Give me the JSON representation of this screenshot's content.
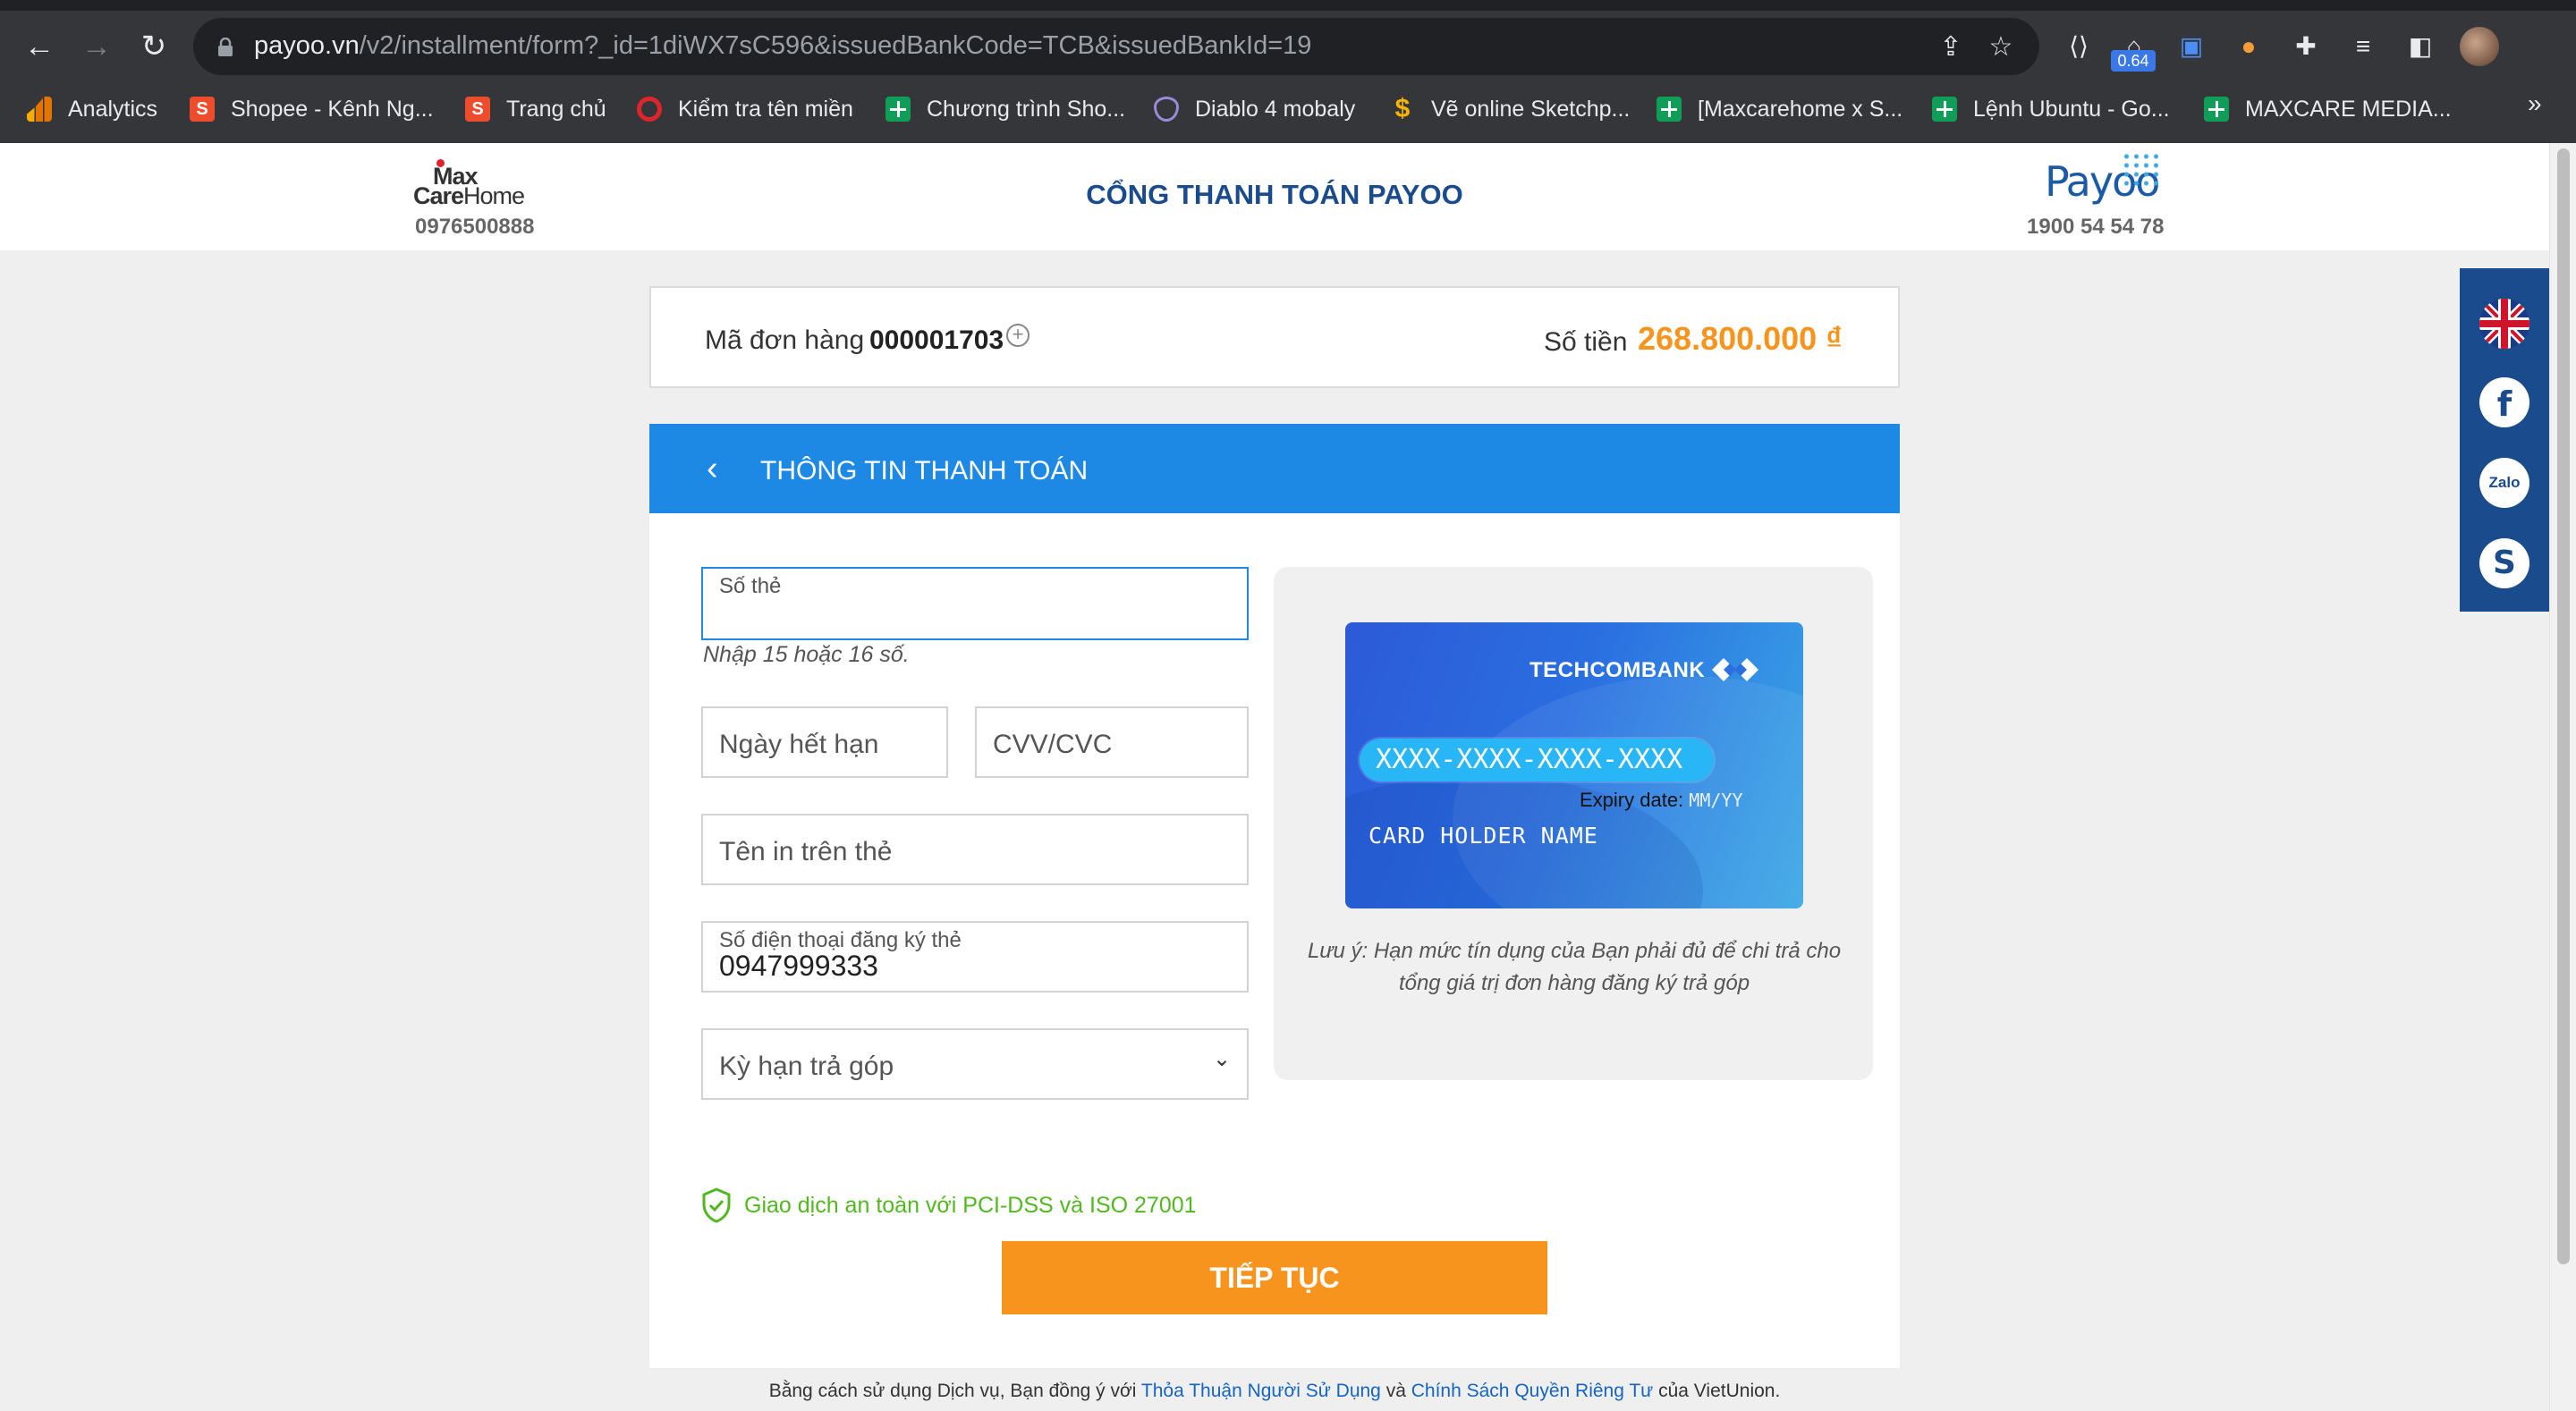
{
  "browser": {
    "url_host": "payoo.vn",
    "url_path": "/v2/installment/form?_id=1diWX7sC596&issuedBankCode=TCB&issuedBankId=19",
    "extension_badge": "0.64",
    "bookmarks": [
      {
        "label": "Analytics",
        "icon": "analytics-icon"
      },
      {
        "label": "Shopee - Kênh Ng...",
        "icon": "shopee-icon"
      },
      {
        "label": "Trang chủ",
        "icon": "shopee-icon"
      },
      {
        "label": "Kiểm tra tên miền",
        "icon": "opera-icon"
      },
      {
        "label": "Chương trình Sho...",
        "icon": "sheets-icon"
      },
      {
        "label": "Diablo 4 mobaly",
        "icon": "diablo-icon"
      },
      {
        "label": "Vẽ online Sketchp...",
        "icon": "sketchpad-icon"
      },
      {
        "label": "[Maxcarehome x S...",
        "icon": "sheets-icon"
      },
      {
        "label": "Lệnh Ubuntu - Go...",
        "icon": "sheets-icon"
      },
      {
        "label": "MAXCARE MEDIA...",
        "icon": "sheets-icon"
      }
    ],
    "more": "»"
  },
  "header": {
    "merchant_logo_line1": "Max",
    "merchant_logo_line2a": "Care",
    "merchant_logo_line2b": "Home",
    "merchant_phone": "0976500888",
    "title": "CỔNG THANH TOÁN PAYOO",
    "payoo_logo": "Payoo",
    "payoo_phone": "1900 54 54 78"
  },
  "order": {
    "label": "Mã đơn hàng",
    "id": "000001703",
    "amount_label": "Số tiền",
    "amount": "268.800.000 ₫"
  },
  "section": {
    "title": "THÔNG TIN THANH TOÁN"
  },
  "form": {
    "card_number_label": "Số thẻ",
    "card_number_hint": "Nhập 15 hoặc 16 số.",
    "expiry_placeholder": "Ngày hết hạn",
    "cvv_placeholder": "CVV/CVC",
    "holder_placeholder": "Tên in trên thẻ",
    "phone_label": "Số điện thoại đăng ký thẻ",
    "phone_value": "0947999333",
    "term_selected": "Kỳ hạn trả góp"
  },
  "card": {
    "bank_name": "TECHCOMBANK",
    "number_mask": "XXXX-XXXX-XXXX-XXXX",
    "expiry_label": "Expiry date:",
    "expiry_mask": "MM/YY",
    "holder_mask": "CARD HOLDER NAME",
    "note": "Lưu ý: Hạn mức tín dụng của Bạn phải đủ để chi trả cho tổng giá trị đơn hàng đăng ký trả góp"
  },
  "security_text": "Giao dịch an toàn với PCI-DSS và ISO 27001",
  "submit_label": "TIẾP TỤC",
  "footer": {
    "prefix": "Bằng cách sử dụng Dịch vụ, Bạn đồng ý với",
    "terms": "Thỏa Thuận Người Sử Dụng",
    "and": "và",
    "privacy": "Chính Sách Quyền Riêng Tư",
    "suffix": "của VietUnion."
  },
  "social": {
    "zalo": "Zalo",
    "facebook": "f",
    "skype": "S"
  },
  "colors": {
    "primary_blue": "#1e88e5",
    "accent_orange": "#f7941d",
    "secure_green": "#52b81f",
    "dark_navy": "#1a4b8c"
  }
}
